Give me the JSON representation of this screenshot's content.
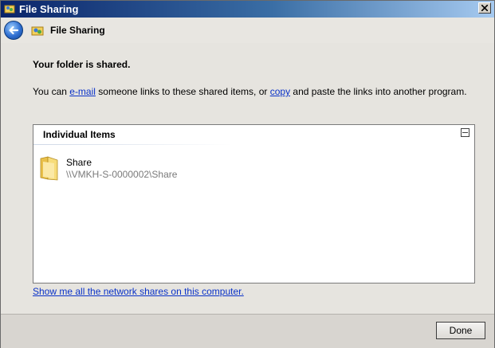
{
  "window": {
    "title": "File Sharing",
    "title_icon": "file-sharing-icon"
  },
  "nav": {
    "back_icon": "back-arrow-icon",
    "title": "File Sharing"
  },
  "content": {
    "heading": "Your folder is shared.",
    "desc_part1": "You can ",
    "email_link": "e-mail",
    "desc_part2": " someone links to these shared items, or ",
    "copy_link": "copy",
    "desc_part3": " and paste the links into another program."
  },
  "items_panel": {
    "header": "Individual Items",
    "items": [
      {
        "name": "Share",
        "path": "\\\\VMKH-S-0000002\\Share",
        "icon": "folder-icon"
      }
    ]
  },
  "network_link": "Show me all the network shares on this computer.",
  "footer": {
    "done_label": "Done"
  },
  "colors": {
    "link": "#0a32c8",
    "path_gray": "#7a7a7a"
  }
}
